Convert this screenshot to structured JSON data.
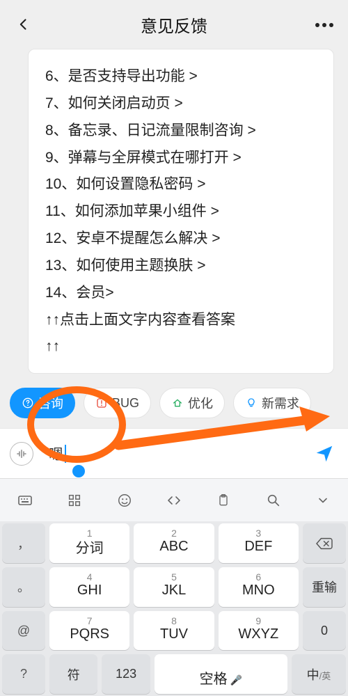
{
  "header": {
    "title": "意见反馈"
  },
  "faq": {
    "lines": [
      "6、是否支持导出功能 >",
      "7、如何关闭启动页 >",
      "8、备忘录、日记流量限制咨询 >",
      "9、弹幕与全屏模式在哪打开 >",
      "10、如何设置隐私密码 >",
      "11、如何添加苹果小组件 >",
      "12、安卓不提醒怎么解决 >",
      "13、如何使用主题换肤 >",
      "14、会员>",
      "↑↑点击上面文字内容查看答案",
      "↑↑"
    ]
  },
  "tabs": {
    "consult": "咨询",
    "bug": "BUG",
    "optimize": "优化",
    "newreq": "新需求"
  },
  "input": {
    "value": "嗯"
  },
  "keyboard": {
    "r1": {
      "c1_num": "1",
      "c1_main": "分词",
      "c2_num": "2",
      "c2_main": "ABC",
      "c3_num": "3",
      "c3_main": "DEF"
    },
    "r2": {
      "c1_num": "4",
      "c1_main": "GHI",
      "c2_num": "5",
      "c2_main": "JKL",
      "c3_num": "6",
      "c3_main": "MNO",
      "side": "重输"
    },
    "r3": {
      "c1_num": "7",
      "c1_main": "PQRS",
      "c2_num": "8",
      "c2_main": "TUV",
      "c3_num": "9",
      "c3_main": "WXYZ",
      "side": "0"
    },
    "r4": {
      "sym": "符",
      "num": "123",
      "space": "空格",
      "cn": "中",
      "en": "英"
    },
    "side_syms": {
      "comma": "，",
      "period": "。",
      "at": "@",
      "q": "?"
    }
  }
}
